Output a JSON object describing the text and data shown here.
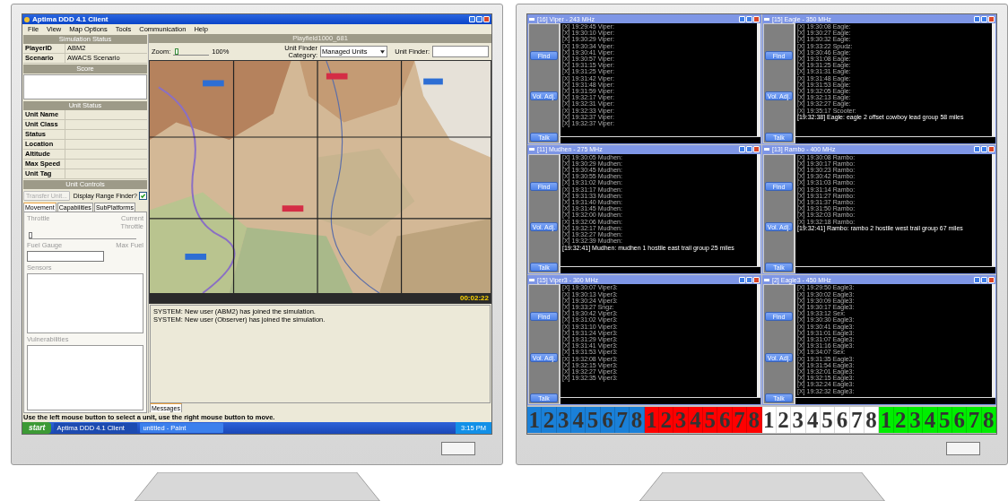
{
  "left_screen": {
    "window": {
      "title": "Aptima DDD 4.1 Client"
    },
    "menu": [
      "File",
      "View",
      "Map Options",
      "Tools",
      "Communication",
      "Help"
    ],
    "simulation_status": {
      "title": "Simulation Status",
      "rows": [
        {
          "label": "PlayerID",
          "value": "ABM2"
        },
        {
          "label": "Scenario",
          "value": "AWACS Scenario"
        }
      ]
    },
    "score": {
      "title": "Score"
    },
    "unit_status": {
      "title": "Unit Status",
      "rows": [
        "Unit Name",
        "Unit Class",
        "Status",
        "Location",
        "Altitude",
        "Max Speed",
        "Unit Tag"
      ]
    },
    "unit_controls": {
      "title": "Unit Controls",
      "transfer_button": {
        "label": "Transfer Unit...",
        "disabled": true
      },
      "range_finder": {
        "label": "Display Range Finder?",
        "checked": true
      },
      "tabs": [
        {
          "label": "Movement",
          "selected": true
        },
        {
          "label": "Capabilities",
          "selected": false
        },
        {
          "label": "SubPlatforms",
          "selected": false
        }
      ],
      "throttle": {
        "label": "Throttle",
        "current_label": "Current Throttle",
        "level": 0
      },
      "fuel": {
        "label": "Fuel Gauge",
        "max_label": "Max Fuel"
      },
      "sensors_label": "Sensors",
      "vulnerabilities_label": "Vulnerabilities"
    },
    "playfield": {
      "title": "Playfield1000_681",
      "zoom_label": "Zoom:",
      "zoom": {
        "level": 0.05
      },
      "zoom_reading": "100%",
      "category_label": "Unit Finder Category:",
      "category_value": "Managed Units",
      "finder_label": "Unit Finder:",
      "clock": "00:02:22"
    },
    "messages": {
      "lines": [
        "SYSTEM: New user (ABM2) has joined the simulation.",
        "SYSTEM: New user (Observer) has joined the simulation."
      ],
      "tab": "Messages"
    },
    "status_bar": "Use the left mouse button to select a unit, use the right mouse button to move.",
    "taskbar": {
      "start": "start",
      "items": [
        {
          "label": "Aptima DDD 4.1 Client",
          "selected": true
        },
        {
          "label": "untitled - Paint",
          "selected": false
        }
      ],
      "clock": "3:15 PM"
    }
  },
  "right_screen": {
    "radios": [
      {
        "title": "[16] Viper - 243 MHz",
        "buttons": [
          "Find",
          "Vol. Adj.",
          "Talk"
        ],
        "log": [
          {
            "text": "[X] 19:29:45 Viper:",
            "bright": false
          },
          {
            "text": "[X] 19:30:10 Viper:",
            "bright": false
          },
          {
            "text": "[X] 19:30:29 Viper:",
            "bright": false
          },
          {
            "text": "[X] 19:30:34 Viper:",
            "bright": false
          },
          {
            "text": "[X] 19:30:41 Viper:",
            "bright": false
          },
          {
            "text": "[X] 19:30:57 Viper:",
            "bright": false
          },
          {
            "text": "[X] 19:31:15 Viper:",
            "bright": false
          },
          {
            "text": "[X] 19:31:25 Viper:",
            "bright": false
          },
          {
            "text": "[X] 19:31:42 Viper:",
            "bright": false
          },
          {
            "text": "[X] 19:31:48 Viper:",
            "bright": false
          },
          {
            "text": "[X] 19:31:59 Viper:",
            "bright": false
          },
          {
            "text": "[X] 19:32:17 Viper:",
            "bright": false
          },
          {
            "text": "[X] 19:32:31 Viper:",
            "bright": false
          },
          {
            "text": "[X] 19:32:33 Viper:",
            "bright": false
          },
          {
            "text": "[X] 19:32:37 Viper:",
            "bright": false
          },
          {
            "text": "[X] 19:32:37 Viper:",
            "bright": false
          }
        ]
      },
      {
        "title": "[15] Eagle - 350 MHz",
        "buttons": [
          "Find",
          "Vol. Adj.",
          "Talk"
        ],
        "log": [
          {
            "text": "[X] 19:30:08 Eagle:",
            "bright": false
          },
          {
            "text": "[X] 19:30:27 Eagle:",
            "bright": false
          },
          {
            "text": "[X] 19:30:32 Eagle:",
            "bright": false
          },
          {
            "text": "[X] 19:33:22 Spudz:",
            "bright": false
          },
          {
            "text": "[X] 19:30:46 Eagle:",
            "bright": false
          },
          {
            "text": "[X] 19:31:08 Eagle:",
            "bright": false
          },
          {
            "text": "[X] 19:31:25 Eagle:",
            "bright": false
          },
          {
            "text": "[X] 19:31:31 Eagle:",
            "bright": false
          },
          {
            "text": "[X] 19:31:48 Eagle:",
            "bright": false
          },
          {
            "text": "[X] 19:31:53 Eagle:",
            "bright": false
          },
          {
            "text": "[X] 19:32:05 Eagle:",
            "bright": false
          },
          {
            "text": "[X] 19:32:13 Eagle:",
            "bright": false
          },
          {
            "text": "[X] 19:32:27 Eagle:",
            "bright": false
          },
          {
            "text": "[X] 19:35:17 Scooter:",
            "bright": false
          },
          {
            "text": "[19:32:38] Eagle: eagle 2 offset cowboy lead group 58 miles",
            "bright": true
          }
        ]
      },
      {
        "title": "[11] Mudhen - 275 MHz",
        "buttons": [
          "Find",
          "Vol. Adj.",
          "Talk"
        ],
        "log": [
          {
            "text": "[X] 19:30:05 Mudhen:",
            "bright": false
          },
          {
            "text": "[X] 19:30:29 Mudhen:",
            "bright": false
          },
          {
            "text": "[X] 19:30:45 Mudhen:",
            "bright": false
          },
          {
            "text": "[X] 19:30:55 Mudhen:",
            "bright": false
          },
          {
            "text": "[X] 19:31:02 Mudhen:",
            "bright": false
          },
          {
            "text": "[X] 19:31:17 Mudhen:",
            "bright": false
          },
          {
            "text": "[X] 19:31:33 Mudhen:",
            "bright": false
          },
          {
            "text": "[X] 19:31:40 Mudhen:",
            "bright": false
          },
          {
            "text": "[X] 19:31:45 Mudhen:",
            "bright": false
          },
          {
            "text": "[X] 19:32:00 Mudhen:",
            "bright": false
          },
          {
            "text": "[X] 19:32:06 Mudhen:",
            "bright": false
          },
          {
            "text": "[X] 19:32:17 Mudhen:",
            "bright": false
          },
          {
            "text": "[X] 19:32:27 Mudhen:",
            "bright": false
          },
          {
            "text": "[X] 19:32:39 Mudhen:",
            "bright": false
          },
          {
            "text": "[19:32:41] Mudhen: mudhen 1 hostile east trail group 25 miles",
            "bright": true
          }
        ]
      },
      {
        "title": "[13] Rambo - 400 MHz",
        "buttons": [
          "Find",
          "Vol. Adj.",
          "Talk"
        ],
        "log": [
          {
            "text": "[X] 19:30:08 Rambo:",
            "bright": false
          },
          {
            "text": "[X] 19:30:17 Rambo:",
            "bright": false
          },
          {
            "text": "[X] 19:30:23 Rambo:",
            "bright": false
          },
          {
            "text": "[X] 19:30:42 Rambo:",
            "bright": false
          },
          {
            "text": "[X] 19:31:03 Rambo:",
            "bright": false
          },
          {
            "text": "[X] 19:31:14 Rambo:",
            "bright": false
          },
          {
            "text": "[X] 19:31:27 Rambo:",
            "bright": false
          },
          {
            "text": "[X] 19:31:37 Rambo:",
            "bright": false
          },
          {
            "text": "[X] 19:31:50 Rambo:",
            "bright": false
          },
          {
            "text": "[X] 19:32:03 Rambo:",
            "bright": false
          },
          {
            "text": "[X] 19:32:18 Rambo:",
            "bright": false
          },
          {
            "text": "[19:32:41] Rambo: rambo 2 hostile west trail group 67 miles",
            "bright": true
          }
        ]
      },
      {
        "title": "[15] Viper3 - 300 MHz",
        "buttons": [
          "Find",
          "Vol. Adj.",
          "Talk"
        ],
        "log": [
          {
            "text": "[X] 19:30:07 Viper3:",
            "bright": false
          },
          {
            "text": "[X] 19:30:13 Viper3:",
            "bright": false
          },
          {
            "text": "[X] 19:30:24 Viper3:",
            "bright": false
          },
          {
            "text": "[X] 19:33:27 Sngz:",
            "bright": false
          },
          {
            "text": "[X] 19:30:42 Viper3:",
            "bright": false
          },
          {
            "text": "[X] 19:31:02 Viper3:",
            "bright": false
          },
          {
            "text": "[X] 19:31:10 Viper3:",
            "bright": false
          },
          {
            "text": "[X] 19:31:24 Viper3:",
            "bright": false
          },
          {
            "text": "[X] 19:31:29 Viper3:",
            "bright": false
          },
          {
            "text": "[X] 19:31:41 Viper3:",
            "bright": false
          },
          {
            "text": "[X] 19:31:53 Viper3:",
            "bright": false
          },
          {
            "text": "[X] 19:32:08 Viper3:",
            "bright": false
          },
          {
            "text": "[X] 19:32:15 Viper3:",
            "bright": false
          },
          {
            "text": "[X] 19:32:27 Viper3:",
            "bright": false
          },
          {
            "text": "[X] 19:32:35 Viper3:",
            "bright": false
          }
        ]
      },
      {
        "title": "[2] Eagle3 - 450 MHz",
        "buttons": [
          "Find",
          "Vol. Adj.",
          "Talk"
        ],
        "log": [
          {
            "text": "[X] 19:29:50 Eagle3:",
            "bright": false
          },
          {
            "text": "[X] 19:30:02 Eagle3:",
            "bright": false
          },
          {
            "text": "[X] 19:30:09 Eagle3:",
            "bright": false
          },
          {
            "text": "[X] 19:30:17 Eagle3:",
            "bright": false
          },
          {
            "text": "[X] 19:33:12 Sex:",
            "bright": false
          },
          {
            "text": "[X] 19:30:30 Eagle3:",
            "bright": false
          },
          {
            "text": "[X] 19:30:41 Eagle3:",
            "bright": false
          },
          {
            "text": "[X] 19:31:01 Eagle3:",
            "bright": false
          },
          {
            "text": "[X] 19:31:07 Eagle3:",
            "bright": false
          },
          {
            "text": "[X] 19:31:16 Eagle3:",
            "bright": false
          },
          {
            "text": "[X] 19:34:07 Sex:",
            "bright": false
          },
          {
            "text": "[X] 19:31:35 Eagle3:",
            "bright": false
          },
          {
            "text": "[X] 19:31:54 Eagle3:",
            "bright": false
          },
          {
            "text": "[X] 19:32:01 Eagle3:",
            "bright": false
          },
          {
            "text": "[X] 19:32:15 Eagle3:",
            "bright": false
          },
          {
            "text": "[X] 19:32:24 Eagle3:",
            "bright": false
          },
          {
            "text": "[X] 19:32:32 Eagle3:",
            "bright": false
          }
        ]
      }
    ],
    "keypad_groups": [
      {
        "color": "#1a80d8",
        "keys": [
          "1",
          "2",
          "3",
          "4",
          "5",
          "6",
          "7",
          "8"
        ]
      },
      {
        "color": "#ff0000",
        "keys": [
          "1",
          "2",
          "3",
          "4",
          "5",
          "6",
          "7",
          "8"
        ]
      },
      {
        "color": "#ffffff",
        "keys": [
          "1",
          "2",
          "3",
          "4",
          "5",
          "6",
          "7",
          "8"
        ]
      },
      {
        "color": "#00ee00",
        "keys": [
          "1",
          "2",
          "3",
          "4",
          "5",
          "6",
          "7",
          "8"
        ]
      }
    ]
  }
}
